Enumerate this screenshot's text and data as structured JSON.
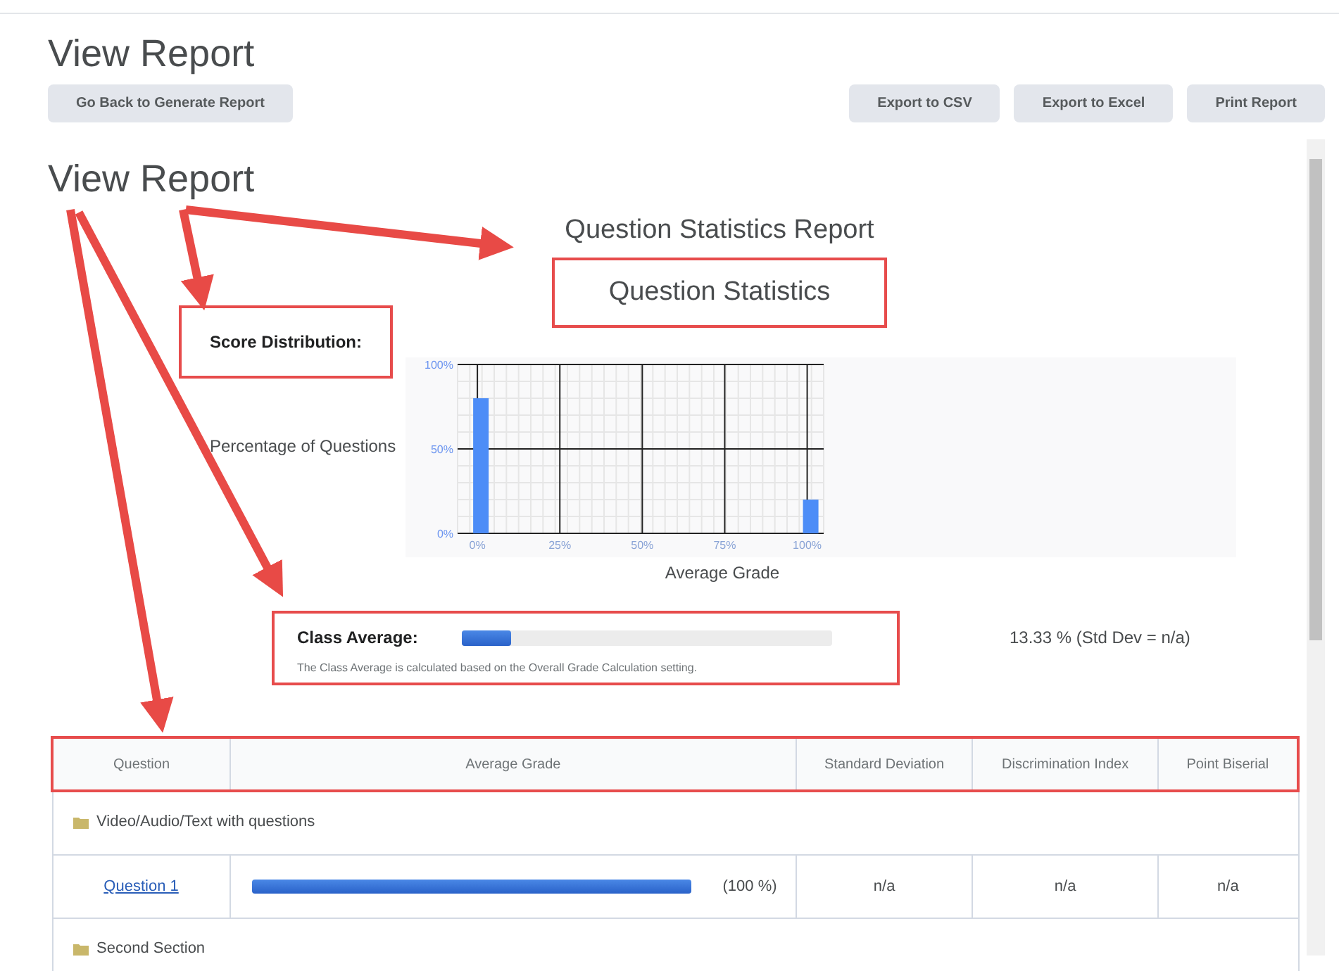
{
  "page": {
    "title": "View Report"
  },
  "toolbar": {
    "back_button": "Go Back to Generate Report",
    "buttons": [
      "Export to CSV",
      "Export to Excel",
      "Print Report"
    ]
  },
  "report": {
    "heading": "View Report",
    "report_title": "Question Statistics Report",
    "section_title": "Question Statistics",
    "score_distribution": {
      "label": "Score Distribution:",
      "chart_data": {
        "type": "bar",
        "xlabel": "Average Grade",
        "ylabel": "Percentage of Questions",
        "x": [
          0,
          100
        ],
        "values": [
          80,
          20
        ],
        "xlim": [
          -6,
          105
        ],
        "grid": true,
        "ylim": [
          0,
          100
        ],
        "xticks": [
          {
            "value": 0,
            "label": "0%"
          },
          {
            "value": 25,
            "label": "25%"
          },
          {
            "value": 50,
            "label": "50%"
          },
          {
            "value": 75,
            "label": "75%"
          },
          {
            "value": 100,
            "label": "100%"
          }
        ],
        "yticks": [
          {
            "value": 0,
            "label": "0%"
          },
          {
            "value": 50,
            "label": "50%"
          },
          {
            "value": 100,
            "label": "100%"
          }
        ]
      }
    },
    "class_average": {
      "label": "Class Average:",
      "level": 0.1333,
      "note": "The Class Average is calculated based on the Overall Grade Calculation setting.",
      "reading": "13.33 % (Std Dev = n/a)"
    },
    "table": {
      "columns": [
        "Question",
        "Average Grade",
        "Standard Deviation",
        "Discrimination Index",
        "Point Biserial"
      ],
      "rows": [
        {
          "kind": "section",
          "name": "Video/Audio/Text with questions"
        },
        {
          "kind": "question",
          "name": "Question 1",
          "reading": "(100 %)",
          "std_dev": "n/a",
          "discrimination": "n/a",
          "point_biserial": "n/a"
        },
        {
          "kind": "section",
          "name": "Second Section"
        }
      ]
    }
  }
}
